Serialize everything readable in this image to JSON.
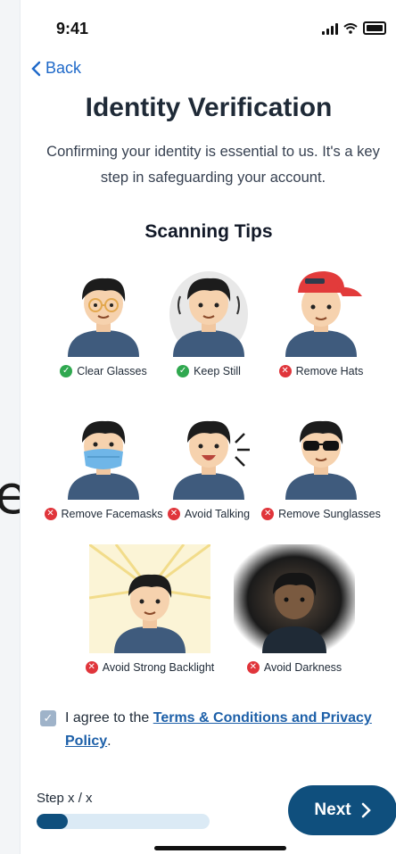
{
  "status_bar": {
    "time": "9:41"
  },
  "nav": {
    "back_label": "Back"
  },
  "page": {
    "title": "Identity Verification",
    "subtitle": "Confirming your identity is essential to us. It's a key step in safeguarding your account.",
    "section_title": "Scanning Tips"
  },
  "tips": [
    {
      "label": "Clear Glasses",
      "status": "ok",
      "icon": "clear-glasses-avatar"
    },
    {
      "label": "Keep Still",
      "status": "ok",
      "icon": "keep-still-avatar"
    },
    {
      "label": "Remove Hats",
      "status": "no",
      "icon": "hat-avatar"
    },
    {
      "label": "Remove Facemasks",
      "status": "no",
      "icon": "facemask-avatar"
    },
    {
      "label": "Avoid Talking",
      "status": "no",
      "icon": "talking-avatar"
    },
    {
      "label": "Remove Sunglasses",
      "status": "no",
      "icon": "sunglasses-avatar"
    },
    {
      "label": "Avoid Strong Backlight",
      "status": "no",
      "icon": "backlight-avatar"
    },
    {
      "label": "Avoid Darkness",
      "status": "no",
      "icon": "darkness-avatar"
    }
  ],
  "agreement": {
    "prefix": "I agree to the ",
    "link": "Terms & Conditions and Privacy Policy",
    "suffix": "."
  },
  "footer": {
    "step_label": "Step x / x",
    "progress": 0.18,
    "next_label": "Next"
  },
  "colors": {
    "primary": "#0f4f7d",
    "link": "#1c5fa8",
    "ok": "#2fa84f",
    "error": "#e0353b"
  }
}
